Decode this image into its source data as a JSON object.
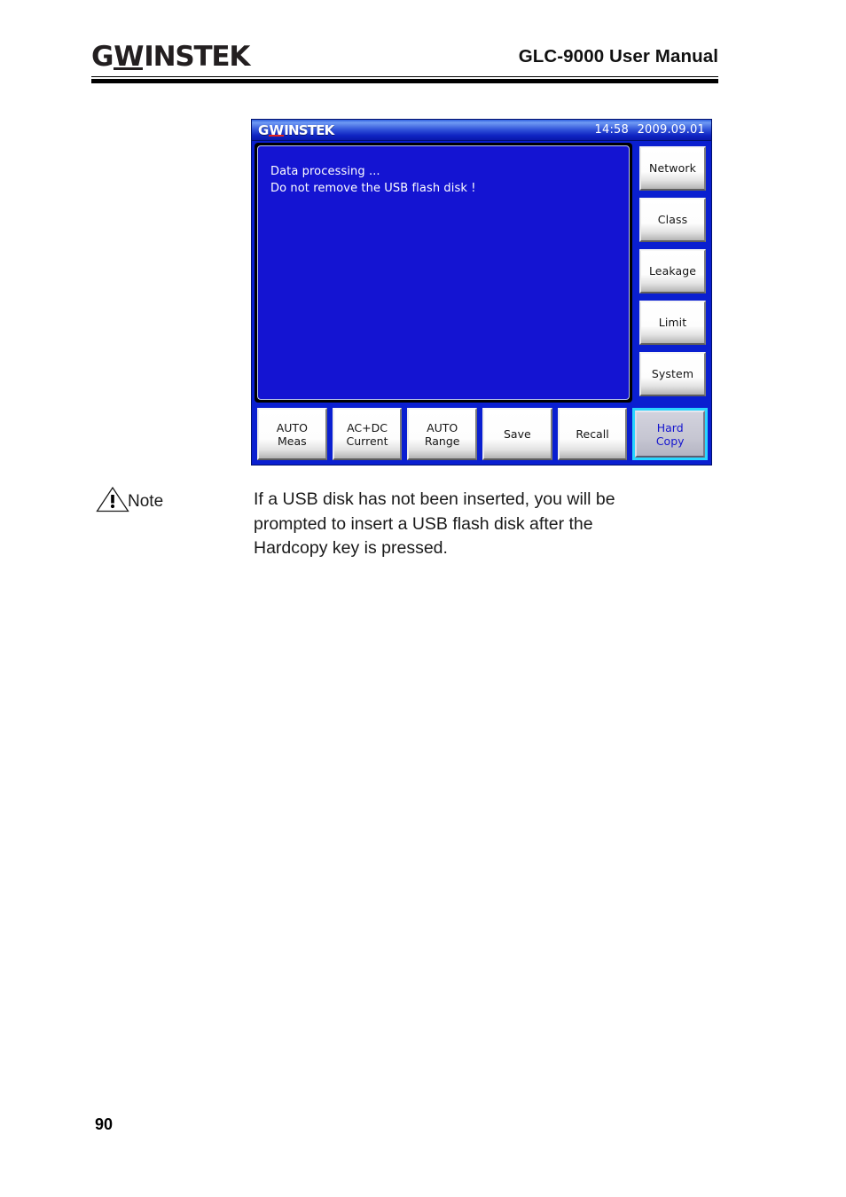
{
  "header": {
    "brand_prefix": "G",
    "brand_w": "W",
    "brand_suffix": "INSTEK",
    "manual_title": "GLC-9000 User Manual"
  },
  "device": {
    "titlebar": {
      "logo_prefix": "G",
      "logo_w": "W",
      "logo_suffix": "INSTEK",
      "time": "14:58",
      "date": "2009.09.01"
    },
    "display": {
      "messages": [
        "Data processing ...",
        "Do not remove the USB flash disk !"
      ]
    },
    "softkeys": [
      {
        "label": "Network"
      },
      {
        "label": "Class"
      },
      {
        "label": "Leakage"
      },
      {
        "label": "Limit"
      },
      {
        "label": "System"
      }
    ],
    "function_keys": [
      {
        "line1": "AUTO",
        "line2": "Meas",
        "selected": false
      },
      {
        "line1": "AC+DC",
        "line2": "Current",
        "selected": false
      },
      {
        "line1": "AUTO",
        "line2": "Range",
        "selected": false
      },
      {
        "line1": "Save",
        "line2": "",
        "selected": false
      },
      {
        "line1": "Recall",
        "line2": "",
        "selected": false
      },
      {
        "line1": "Hard",
        "line2": "Copy",
        "selected": true
      }
    ]
  },
  "note": {
    "label": "Note",
    "icon": "warning-triangle-icon",
    "lines": [
      "If a USB disk has not been inserted, you will be",
      "prompted to insert a USB flash disk after the",
      "Hardcopy key is pressed."
    ]
  },
  "footer": {
    "page_number": "90"
  },
  "colors": {
    "screen_blue": "#0a1fd0",
    "pane_blue": "#1414d2",
    "selection_cyan": "#2ad6ff",
    "selected_text_blue": "#1515cf",
    "logo_red": "#e02020",
    "ink": "#1a1a1a"
  }
}
